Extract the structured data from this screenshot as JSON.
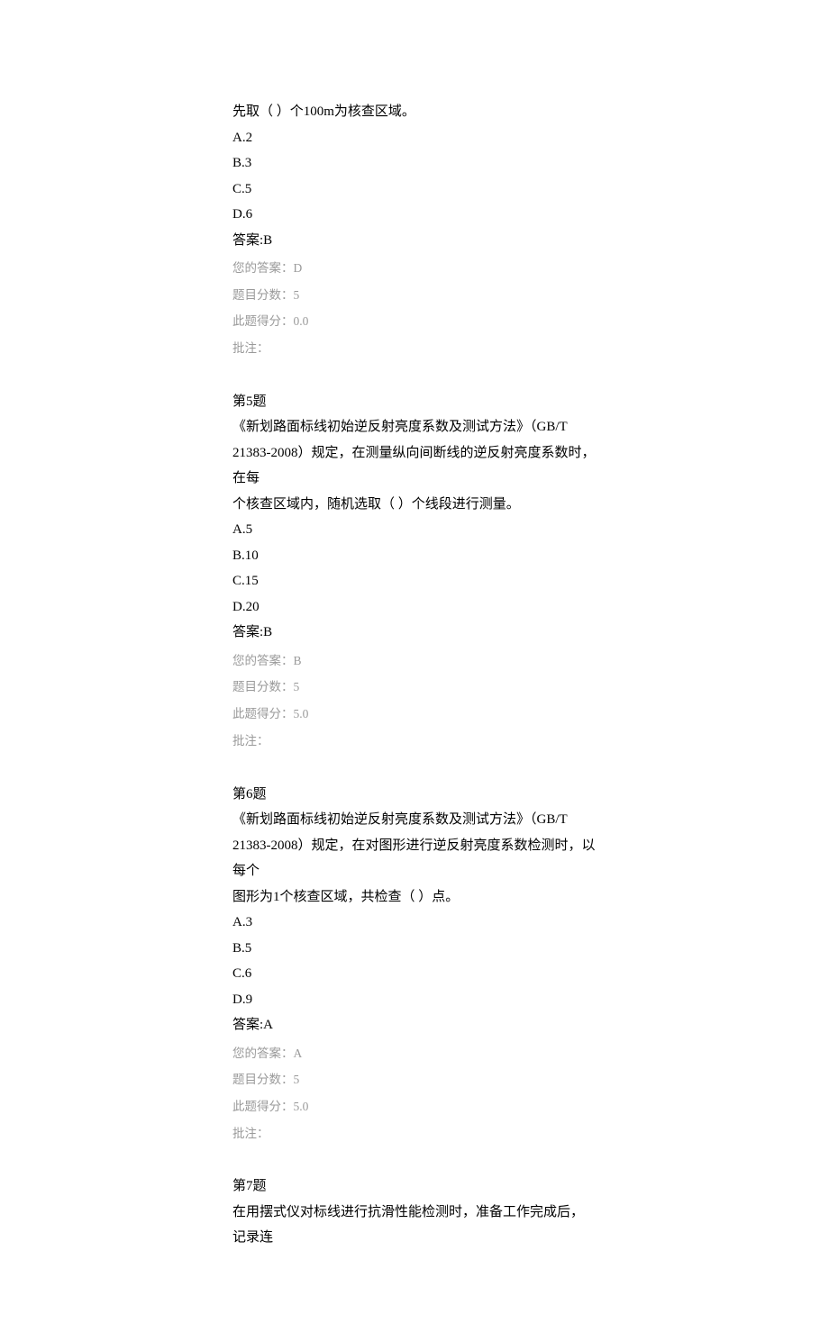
{
  "q4": {
    "stem_line": "先取（ ）个100m为核查区域。",
    "opts": {
      "a": "A.2",
      "b": "B.3",
      "c": "C.5",
      "d": "D.6"
    },
    "answer_label": "答案:B",
    "your_answer": "您的答案：D",
    "topic_score": "题目分数：5",
    "this_score": "此题得分：0.0",
    "remark": "批注："
  },
  "q5": {
    "title": "第5题",
    "stem1": "《新划路面标线初始逆反射亮度系数及测试方法》（GB/T",
    "stem2": "21383-2008）规定，在测量纵向间断线的逆反射亮度系数时，在每",
    "stem3": "个核查区域内，随机选取（ ）个线段进行测量。",
    "opts": {
      "a": "A.5",
      "b": "B.10",
      "c": "C.15",
      "d": "D.20"
    },
    "answer_label": "答案:B",
    "your_answer": "您的答案：B",
    "topic_score": "题目分数：5",
    "this_score": "此题得分：5.0",
    "remark": "批注："
  },
  "q6": {
    "title": "第6题",
    "stem1": "《新划路面标线初始逆反射亮度系数及测试方法》（GB/T",
    "stem2": "21383-2008）规定，在对图形进行逆反射亮度系数检测时，以每个",
    "stem3": "图形为1个核查区域，共检查（ ）点。",
    "opts": {
      "a": "A.3",
      "b": "B.5",
      "c": "C.6",
      "d": "D.9"
    },
    "answer_label": "答案:A",
    "your_answer": "您的答案：A",
    "topic_score": "题目分数：5",
    "this_score": "此题得分：5.0",
    "remark": "批注："
  },
  "q7": {
    "title": "第7题",
    "stem1": "在用摆式仪对标线进行抗滑性能检测时，准备工作完成后，记录连"
  }
}
